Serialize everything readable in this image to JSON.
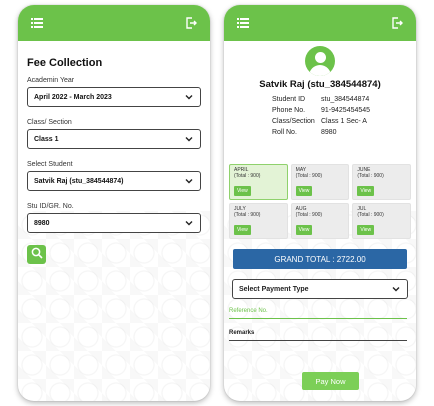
{
  "brand_color": "#6cc24a",
  "left": {
    "section_title": "Fee Collection",
    "academic_year": {
      "label": "Academin Year",
      "value": "April 2022 - March 2023"
    },
    "class_section": {
      "label": "Class/ Section",
      "value": "Class 1"
    },
    "student": {
      "label": "Select Student",
      "value": "Satvik Raj (stu_384544874)"
    },
    "stu_id": {
      "label": "Stu ID/GR. No.",
      "value": "8980"
    },
    "search_icon": "search-icon"
  },
  "right": {
    "student_name": "Satvik Raj (stu_384544874)",
    "info": [
      {
        "key": "Student ID",
        "value": "stu_384544874"
      },
      {
        "key": "Phone No.",
        "value": "91-9425454545"
      },
      {
        "key": "Class/Section",
        "value": "Class 1 Sec- A"
      },
      {
        "key": "Roll No.",
        "value": "8980"
      }
    ],
    "months": [
      {
        "name": "APRIL",
        "total": "(Total : 900)",
        "view": "View"
      },
      {
        "name": "MAY",
        "total": "(Total : 900)",
        "view": "View"
      },
      {
        "name": "JUNE",
        "total": "(Total : 900)",
        "view": "View"
      },
      {
        "name": "JULY",
        "total": "(Total : 900)",
        "view": "View"
      },
      {
        "name": "AUG",
        "total": "(Total : 900)",
        "view": "View"
      },
      {
        "name": "JUL",
        "total": "(Total : 900)",
        "view": "View"
      }
    ],
    "grand_total": "GRAND TOTAL : 2722.00",
    "payment_type": "Select Payment Type",
    "reference_label": "Reference No.",
    "remarks_label": "Remarks",
    "pay_now": "Pay Now"
  }
}
